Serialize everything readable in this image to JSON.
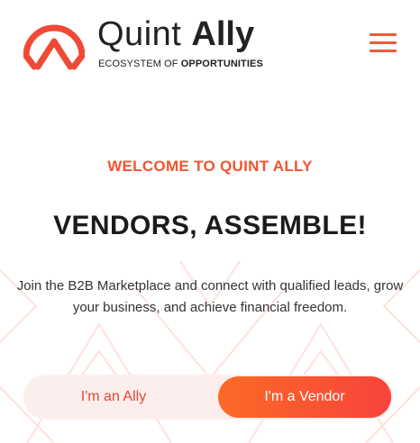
{
  "header": {
    "brand_light": "Quint ",
    "brand_bold": "Ally",
    "tagline_light": "ECOSYSTEM OF ",
    "tagline_bold": "OPPORTUNITIES",
    "logo_icon": "quint-ally-logo-icon",
    "menu_icon": "hamburger-menu-icon"
  },
  "hero": {
    "eyebrow": "WELCOME TO QUINT ALLY",
    "headline": "VENDORS, ASSEMBLE!",
    "description": "Join the B2B Marketplace and connect with qualified leads, grow your business, and achieve financial freedom."
  },
  "toggle": {
    "ally_label": "I'm an Ally",
    "vendor_label": "I'm a Vendor",
    "selected": "I'm a Vendor"
  },
  "colors": {
    "accent": "#ef5530",
    "gradient_start": "#fb6a26",
    "gradient_end": "#f8433c",
    "toggle_bg": "#fdeeee",
    "heading": "#1b1b1b"
  }
}
